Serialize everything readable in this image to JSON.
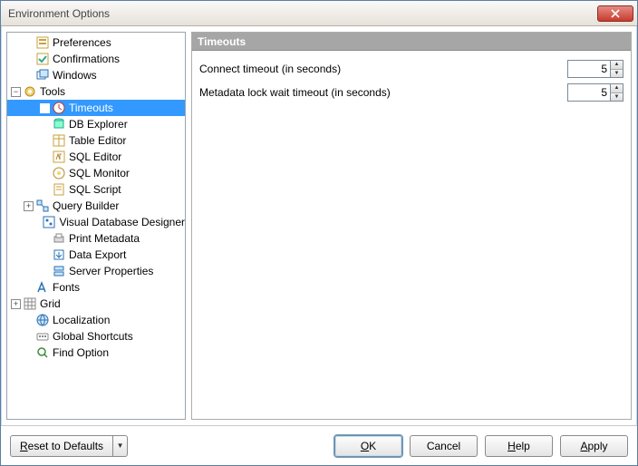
{
  "window": {
    "title": "Environment Options"
  },
  "tree": {
    "items": [
      {
        "label": "Preferences",
        "depth": 1,
        "exp": "",
        "icon": "pref",
        "sel": false
      },
      {
        "label": "Confirmations",
        "depth": 1,
        "exp": "",
        "icon": "conf",
        "sel": false
      },
      {
        "label": "Windows",
        "depth": 1,
        "exp": "",
        "icon": "wins",
        "sel": false
      },
      {
        "label": "Tools",
        "depth": 0,
        "exp": "−",
        "icon": "tools",
        "sel": false
      },
      {
        "label": "Timeouts",
        "depth": 2,
        "exp": "",
        "icon": "timeout",
        "sel": true
      },
      {
        "label": "DB Explorer",
        "depth": 2,
        "exp": "",
        "icon": "dbexp",
        "sel": false
      },
      {
        "label": "Table Editor",
        "depth": 2,
        "exp": "",
        "icon": "tbled",
        "sel": false
      },
      {
        "label": "SQL Editor",
        "depth": 2,
        "exp": "",
        "icon": "sqle",
        "sel": false
      },
      {
        "label": "SQL Monitor",
        "depth": 2,
        "exp": "",
        "icon": "sqlm",
        "sel": false
      },
      {
        "label": "SQL Script",
        "depth": 2,
        "exp": "",
        "icon": "sqls",
        "sel": false
      },
      {
        "label": "Query Builder",
        "depth": 1,
        "exp": "+",
        "icon": "qb",
        "sel": false
      },
      {
        "label": "Visual Database Designer",
        "depth": 2,
        "exp": "",
        "icon": "vdd",
        "sel": false
      },
      {
        "label": "Print Metadata",
        "depth": 2,
        "exp": "",
        "icon": "print",
        "sel": false
      },
      {
        "label": "Data Export",
        "depth": 2,
        "exp": "",
        "icon": "export",
        "sel": false
      },
      {
        "label": "Server Properties",
        "depth": 2,
        "exp": "",
        "icon": "srv",
        "sel": false
      },
      {
        "label": "Fonts",
        "depth": 1,
        "exp": "",
        "icon": "fonts",
        "sel": false
      },
      {
        "label": "Grid",
        "depth": 0,
        "exp": "+",
        "icon": "grid",
        "sel": false
      },
      {
        "label": "Localization",
        "depth": 1,
        "exp": "",
        "icon": "loc",
        "sel": false
      },
      {
        "label": "Global Shortcuts",
        "depth": 1,
        "exp": "",
        "icon": "short",
        "sel": false
      },
      {
        "label": "Find Option",
        "depth": 1,
        "exp": "",
        "icon": "find",
        "sel": false
      }
    ]
  },
  "pane": {
    "title": "Timeouts",
    "rows": [
      {
        "label": "Connect timeout (in seconds)",
        "value": "5"
      },
      {
        "label": "Metadata lock wait timeout (in seconds)",
        "value": "5"
      }
    ]
  },
  "footer": {
    "reset": "Reset to Defaults",
    "ok": "OK",
    "cancel": "Cancel",
    "help": "Help",
    "apply": "Apply"
  }
}
